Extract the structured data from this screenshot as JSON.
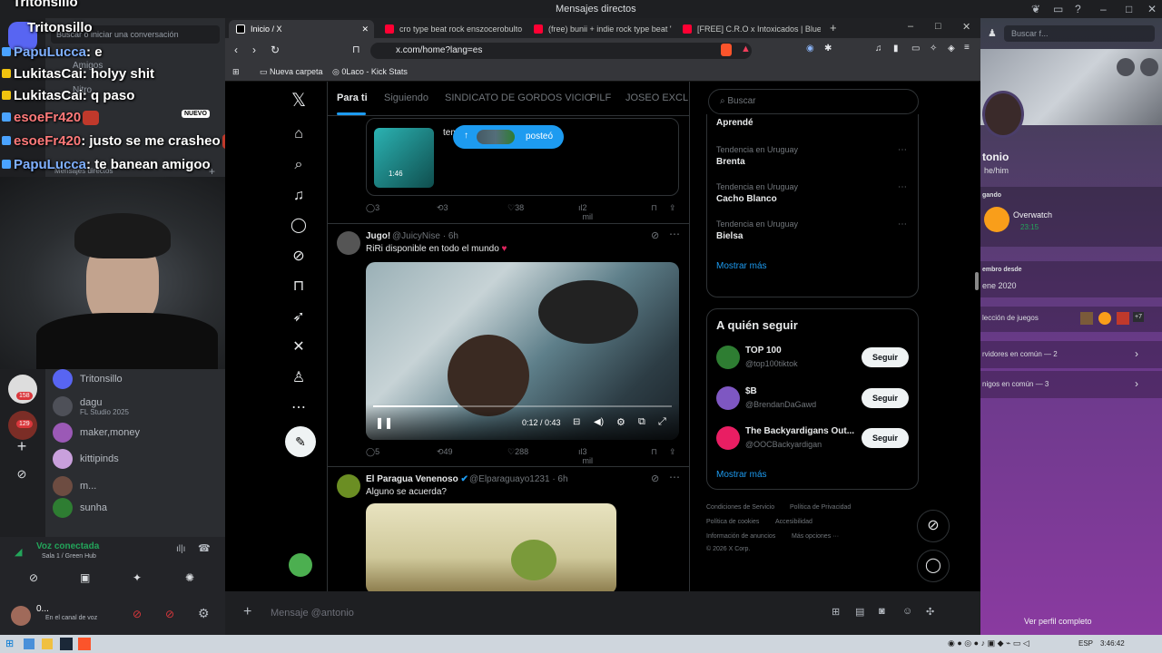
{
  "discord": {
    "window_title": "Mensajes directos",
    "search_placeholder": "Buscar o iniciar una conversación",
    "friends": "Amigos",
    "nitro": "Nitro",
    "new_badge": "NUEVO",
    "dm_header": "Mensajes directos",
    "rail_badges": [
      "158",
      "129"
    ],
    "dms": [
      {
        "name": "Tritonsillo",
        "sub": "",
        "color": "#5865f2"
      },
      {
        "name": "dagu",
        "sub": "FL Studio 2025",
        "color": "#4e5058"
      },
      {
        "name": "maker,money",
        "sub": "",
        "color": "#9b59b6"
      },
      {
        "name": "kittipinds",
        "sub": "",
        "color": "#c9a0dc"
      },
      {
        "name": "m...",
        "sub": "",
        "color": "#6d4c41"
      },
      {
        "name": "sunha",
        "sub": "",
        "color": "#2e7d32"
      }
    ],
    "voice": {
      "status": "Voz conectada",
      "channel": "Sala 1 / Green Hub"
    },
    "user": {
      "name": "0...",
      "status": "En el canal de voz"
    },
    "message_placeholder": "Mensaje @antonio",
    "profile": {
      "name": "tonio",
      "pronouns": "he/him",
      "playing_label": "gando",
      "game": "Overwatch",
      "game_time": "23:15",
      "member_since_label": "embro desde",
      "member_since": "ene 2020",
      "games_label": "lección de juegos",
      "games_more": "+7",
      "servers": "rvidores en común — 2",
      "friends": "nigos en común — 3",
      "view_full": "Ver perfil completo",
      "search": "Buscar f..."
    }
  },
  "chat_overlay": [
    {
      "user": "Tritonsillo",
      "msg": ""
    },
    {
      "user": "Tritonsillo",
      "msg": ""
    },
    {
      "user": "PapuLucca",
      "msg": ": e"
    },
    {
      "user": "LukitasCai",
      "msg": ": holyy shit"
    },
    {
      "user": "LukitasCai",
      "msg": ": q paso"
    },
    {
      "user": "esoeFr420",
      "msg": ""
    },
    {
      "user": "esoeFr420",
      "msg": ": justo se me crasheo"
    },
    {
      "user": "PapuLucca",
      "msg": ": te banean amigoo"
    }
  ],
  "browser": {
    "tabs": [
      {
        "title": "Inicio / X",
        "active": true,
        "fav": "#ffffff"
      },
      {
        "title": "cro type beat rock enszocerobulto - Y",
        "active": false,
        "fav": "#ff0033"
      },
      {
        "title": "(free) bunii + indie rock type beat \"lo",
        "active": false,
        "fav": "#ff0033"
      },
      {
        "title": "[FREE] C.R.O x Intoxicados | Blues Ro",
        "active": false,
        "fav": "#ff0033"
      }
    ],
    "url": "x.com/home?lang=es",
    "bookmarks": [
      "Nueva carpeta",
      "0Laco - Kick Stats"
    ]
  },
  "x": {
    "tabs": [
      "Para ti",
      "Siguiendo",
      "SINDICATO DE GORDOS VICIO",
      "PILF",
      "JOSEO EXCLUSI"
    ],
    "posted_pill": "posteó",
    "post1": {
      "duration": "1:46",
      "text_fragment": "tem",
      "replies": "3",
      "reposts": "3",
      "likes": "38",
      "views": "2 mil"
    },
    "post2": {
      "name": "Jugo!",
      "handle": "@JuicyNise · 6h",
      "text": "RiRi disponible en todo el mundo",
      "time": "0:12 / 0:43",
      "replies": "5",
      "reposts": "49",
      "likes": "288",
      "views": "3 mil"
    },
    "post3": {
      "name": "El Paragua Venenoso",
      "handle": "@Elparaguayo1231 · 6h",
      "text": "Alguno se acuerda?"
    },
    "search_placeholder": "Buscar",
    "trends_top": "Aprendé",
    "trends": [
      {
        "meta": "Tendencia en Uruguay",
        "name": "Brenta"
      },
      {
        "meta": "Tendencia en Uruguay",
        "name": "Cacho Blanco"
      },
      {
        "meta": "Tendencia en Uruguay",
        "name": "Bielsa"
      }
    ],
    "show_more": "Mostrar más",
    "who_to_follow": "A quién seguir",
    "follow_label": "Seguir",
    "suggestions": [
      {
        "name": "TOP 100",
        "handle": "@top100tiktok",
        "color": "#2e7d32"
      },
      {
        "name": "$B",
        "handle": "@BrendanDaGawd",
        "color": "#7e57c2"
      },
      {
        "name": "The Backyardigans Out...",
        "handle": "@OOCBackyardigan",
        "color": "#e91e63"
      }
    ],
    "footer": [
      "Condiciones de Servicio",
      "Política de Privacidad",
      "Política de cookies",
      "Accesibilidad",
      "Información de anuncios",
      "Más opciones ···",
      "© 2026 X Corp."
    ]
  },
  "taskbar": {
    "lang": "ESP",
    "time": "3:46:42"
  }
}
